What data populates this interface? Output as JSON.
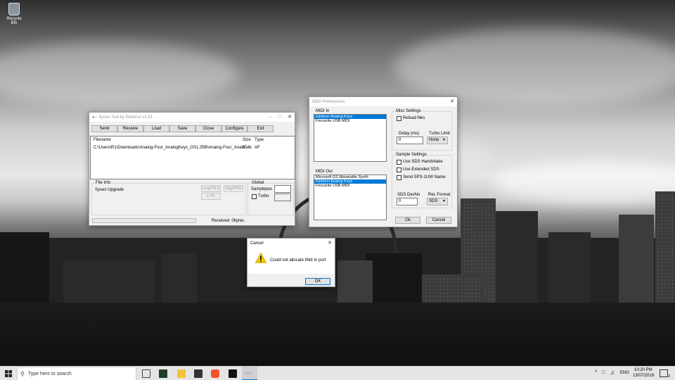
{
  "desktop": {
    "recycle_bin_label": "Recycle Bin"
  },
  "sysex_window": {
    "title": "Sysex Tool by Elektron v1.51",
    "toolbar": [
      "Send",
      "Receive",
      "Load",
      "Save",
      "Close",
      "Configure",
      "Exit"
    ],
    "columns": {
      "filename": "Filename",
      "size": "Size",
      "type": "Type"
    },
    "rows": [
      {
        "filename": "C:\\Users\\R1\\Downloads\\Analog-Four_AnalogKeys_OS1.35B\\Analog-Four_Analo...",
        "size": "854k",
        "type": "AF"
      }
    ],
    "file_info_label": "File Info",
    "file_info_value": "Sysex Upgrade",
    "buttons": {
      "loop_file": "LoopFILE",
      "dig_pro": "DigiPRO",
      "l_r": "L+R"
    },
    "global_label": "Global",
    "samplepos_label": "Samplepos",
    "turbo_label": "Turbo",
    "status": "Received: 0bytes."
  },
  "midi_prefs": {
    "title": "MIDI Preferences",
    "midi_in_label": "MIDI In",
    "midi_in_items": [
      {
        "name": "Elektron Analog Keys",
        "selected": true
      },
      {
        "name": "Focusrite USB MIDI",
        "selected": false
      }
    ],
    "midi_out_label": "MIDI Out",
    "midi_out_items": [
      {
        "name": "Microsoft GS Wavetable Synth",
        "selected": false
      },
      {
        "name": "Elektron Analog Keys",
        "selected": true
      },
      {
        "name": "Focusrite USB MIDI",
        "selected": false
      }
    ],
    "misc_settings_label": "Misc Settings",
    "reload_files_label": "Reload files",
    "delay_label": "Delay (ms)",
    "delay_value": "0",
    "turbo_limit_label": "Turbo Limit",
    "turbo_limit_value": "None",
    "sample_settings_label": "Sample Settings",
    "use_sds_handshake": "Use SDS Handshake",
    "use_extended_sds": "Use Extended SDS",
    "send_sps": "Send SPS-1UW Name",
    "sds_devno_label": "SDS DevNo",
    "sds_devno_value": "0",
    "rec_format_label": "Rec Format",
    "rec_format_value": "SDS",
    "ok": "Ok",
    "cancel": "Cancel"
  },
  "cancel_dialog": {
    "title": "Cancel",
    "message": "Could not allocate Midi In port",
    "ok": "OK"
  },
  "taskbar": {
    "search_placeholder": "Type here to search",
    "language": "ENG",
    "time": "10:20 PM",
    "date": "13/07/2019",
    "notification_count": "3",
    "tray_up": "^"
  }
}
